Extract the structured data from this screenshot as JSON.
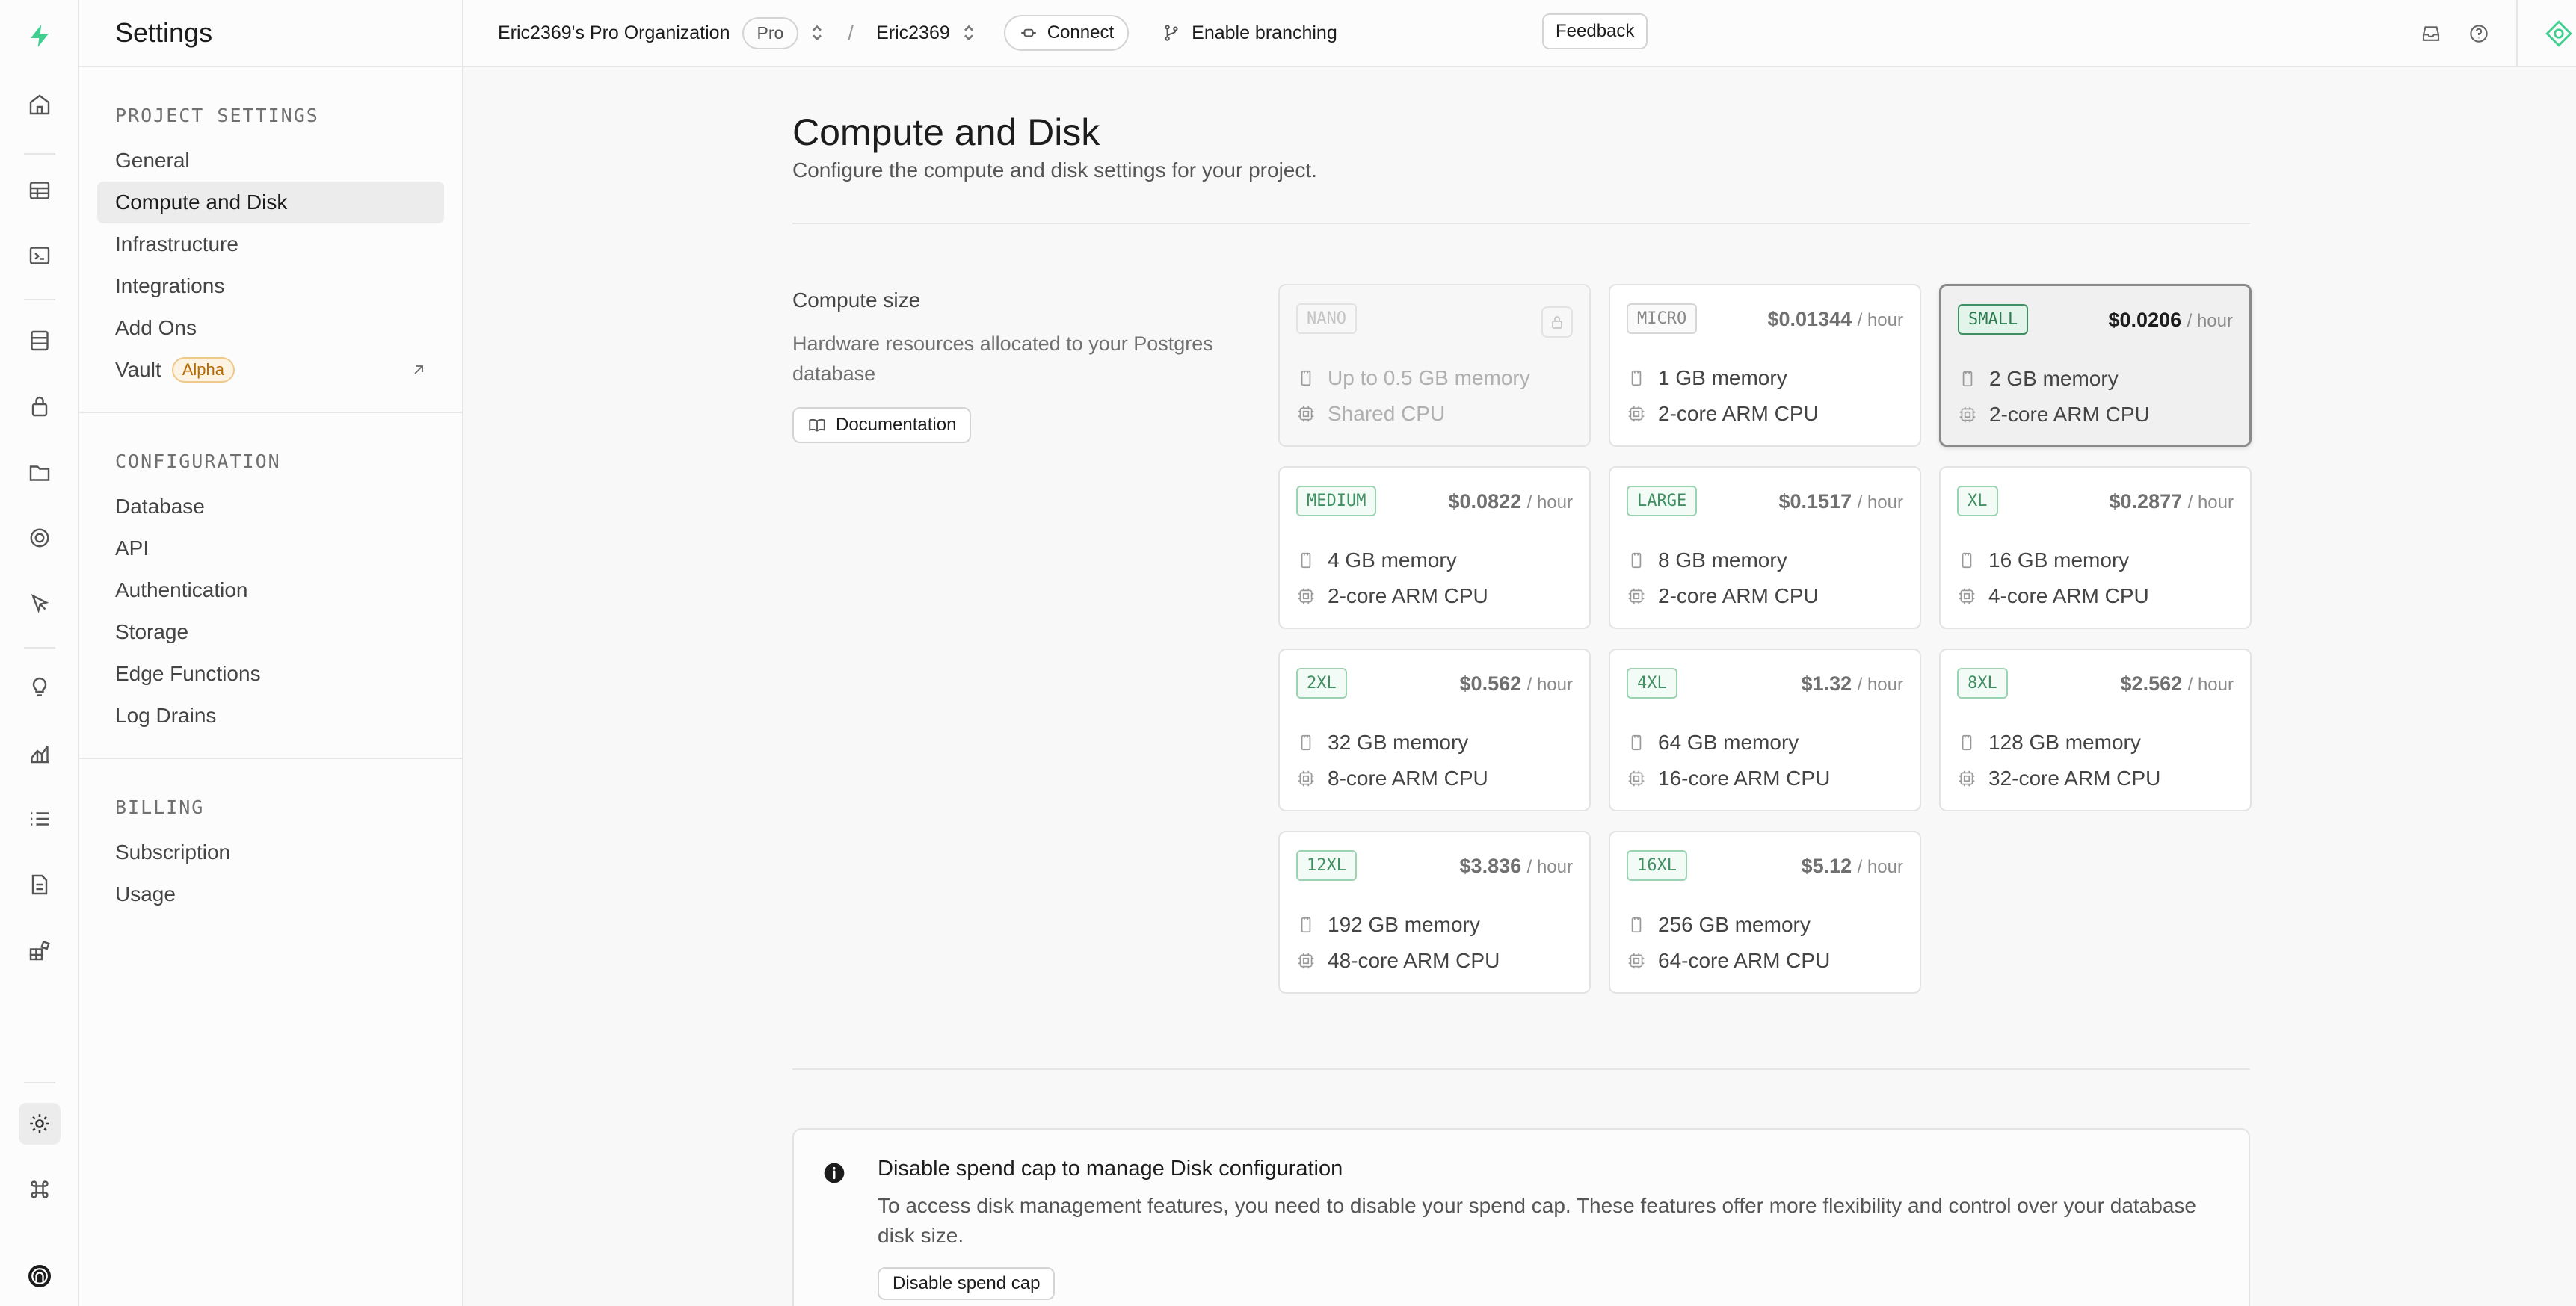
{
  "sidebar": {
    "title": "Settings",
    "groups": [
      {
        "title": "PROJECT SETTINGS",
        "items": [
          {
            "label": "General"
          },
          {
            "label": "Compute and Disk",
            "active": true
          },
          {
            "label": "Infrastructure"
          },
          {
            "label": "Integrations"
          },
          {
            "label": "Add Ons"
          },
          {
            "label": "Vault",
            "badge": "Alpha"
          }
        ]
      },
      {
        "title": "CONFIGURATION",
        "items": [
          {
            "label": "Database"
          },
          {
            "label": "API"
          },
          {
            "label": "Authentication"
          },
          {
            "label": "Storage"
          },
          {
            "label": "Edge Functions"
          },
          {
            "label": "Log Drains"
          }
        ]
      },
      {
        "title": "BILLING",
        "items": [
          {
            "label": "Subscription"
          },
          {
            "label": "Usage"
          }
        ]
      }
    ]
  },
  "topbar": {
    "organization": "Eric2369's Pro Organization",
    "plan": "Pro",
    "separator": "/",
    "project": "Eric2369",
    "connect_label": "Connect",
    "branching_label": "Enable branching",
    "feedback_label": "Feedback"
  },
  "page": {
    "title": "Compute and Disk",
    "subtitle": "Configure the compute and disk settings for your project."
  },
  "compute": {
    "label": "Compute size",
    "description": "Hardware resources allocated to your Postgres database",
    "doc_button": "Documentation",
    "price_unit": "/ hour",
    "options": [
      {
        "name": "NANO",
        "price": "",
        "memory": "Up to 0.5 GB memory",
        "cpu": "Shared CPU",
        "state": "disabled"
      },
      {
        "name": "MICRO",
        "price": "$0.01344",
        "memory": "1 GB memory",
        "cpu": "2-core ARM CPU",
        "state": "normal"
      },
      {
        "name": "SMALL",
        "price": "$0.0206",
        "memory": "2 GB memory",
        "cpu": "2-core ARM CPU",
        "state": "selected"
      },
      {
        "name": "MEDIUM",
        "price": "$0.0822",
        "memory": "4 GB memory",
        "cpu": "2-core ARM CPU",
        "state": "normal"
      },
      {
        "name": "LARGE",
        "price": "$0.1517",
        "memory": "8 GB memory",
        "cpu": "2-core ARM CPU",
        "state": "normal"
      },
      {
        "name": "XL",
        "price": "$0.2877",
        "memory": "16 GB memory",
        "cpu": "4-core ARM CPU",
        "state": "normal"
      },
      {
        "name": "2XL",
        "price": "$0.562",
        "memory": "32 GB memory",
        "cpu": "8-core ARM CPU",
        "state": "normal"
      },
      {
        "name": "4XL",
        "price": "$1.32",
        "memory": "64 GB memory",
        "cpu": "16-core ARM CPU",
        "state": "normal"
      },
      {
        "name": "8XL",
        "price": "$2.562",
        "memory": "128 GB memory",
        "cpu": "32-core ARM CPU",
        "state": "normal"
      },
      {
        "name": "12XL",
        "price": "$3.836",
        "memory": "192 GB memory",
        "cpu": "48-core ARM CPU",
        "state": "normal"
      },
      {
        "name": "16XL",
        "price": "$5.12",
        "memory": "256 GB memory",
        "cpu": "64-core ARM CPU",
        "state": "normal"
      }
    ]
  },
  "disk_notice": {
    "title": "Disable spend cap to manage Disk configuration",
    "text": "To access disk management features, you need to disable your spend cap. These features offer more flexibility and control over your database disk size.",
    "button": "Disable spend cap"
  },
  "colors": {
    "brand": "#3ecf8e",
    "accent_green": "#3f8f62"
  }
}
